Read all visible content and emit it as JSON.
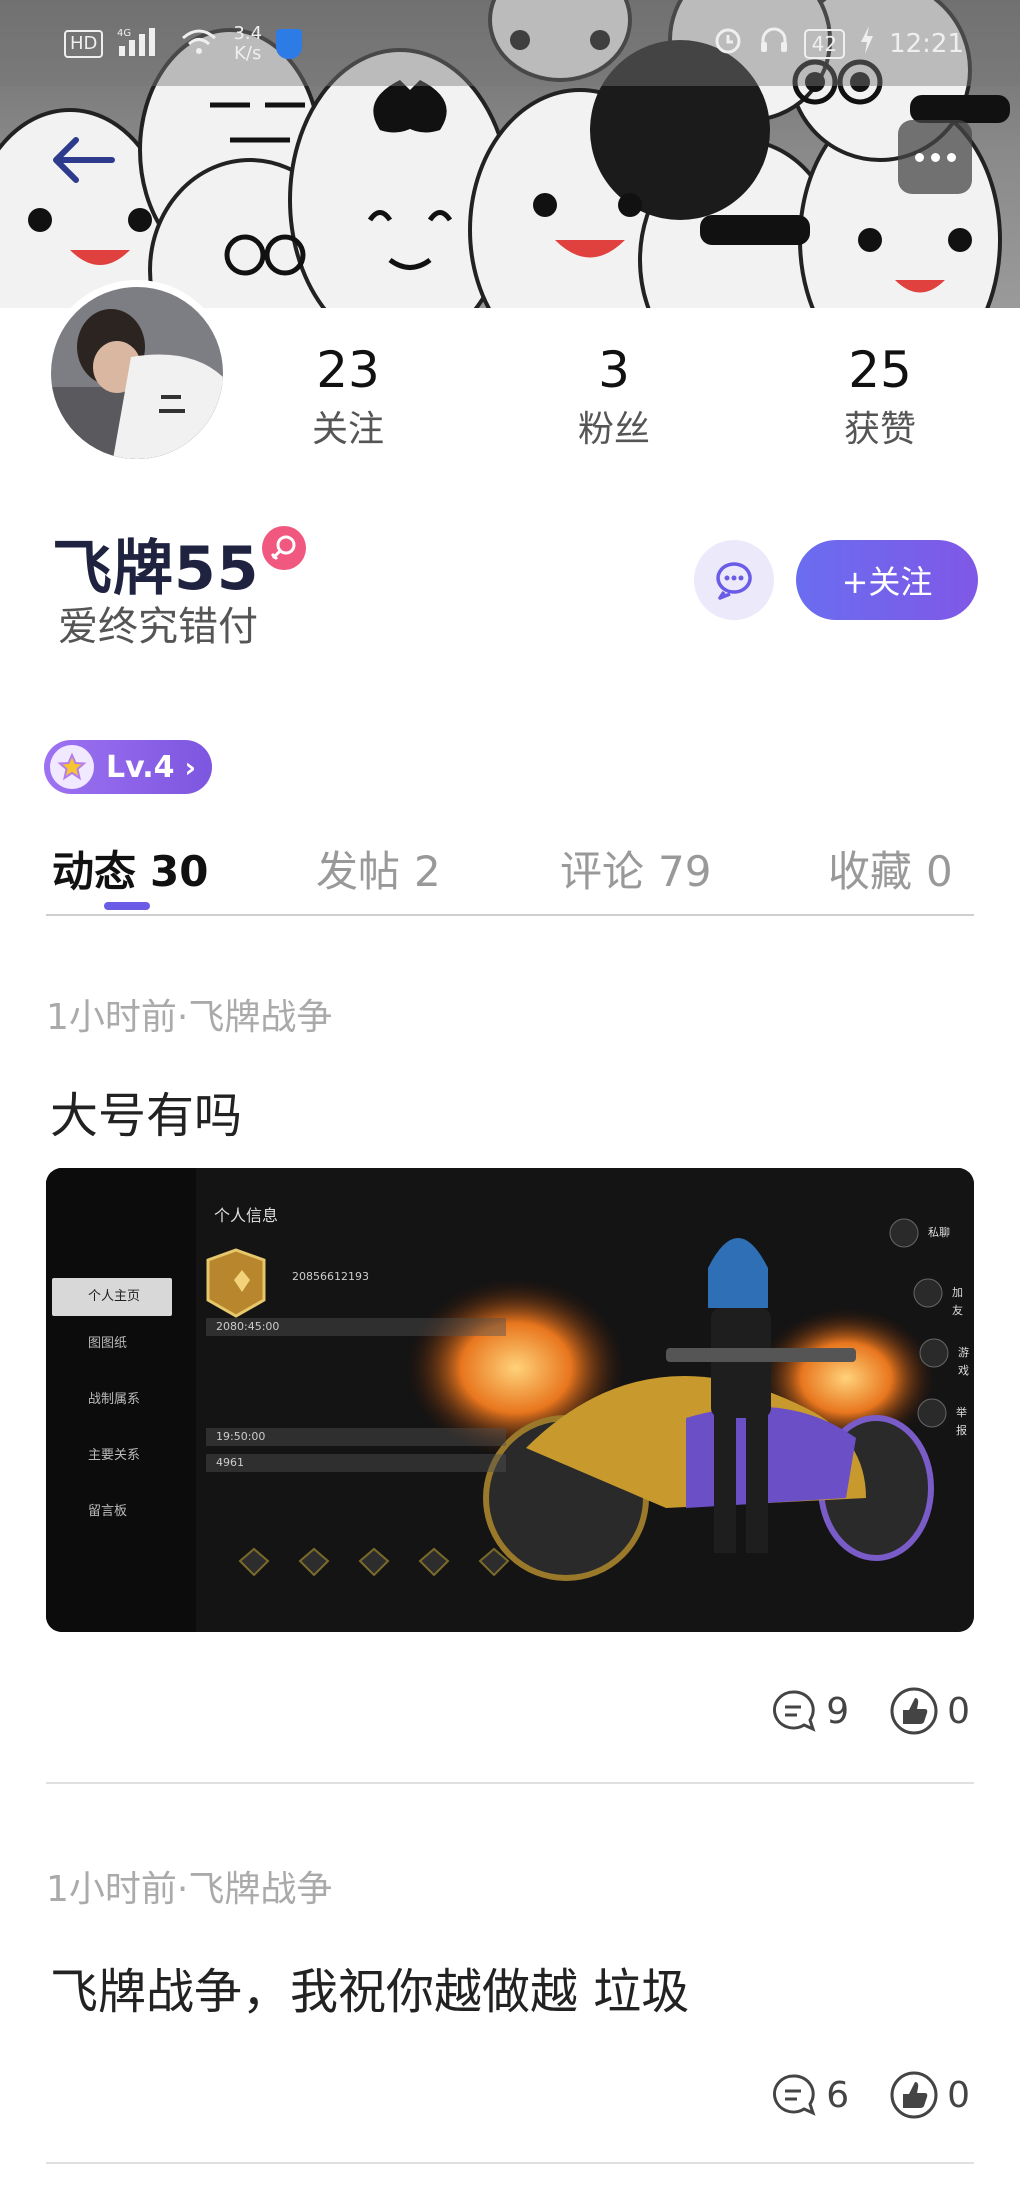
{
  "status_bar": {
    "network": "HD",
    "signal": "4G",
    "speed": "3.4",
    "speed_unit": "K/s",
    "battery": "42",
    "time": "12:21",
    "icons": [
      "hd-icon",
      "signal-icon",
      "wifi-icon",
      "shield-app-icon",
      "alarm-icon",
      "headset-icon",
      "battery-icon",
      "charging-icon"
    ]
  },
  "header": {
    "back_icon": "arrow-left-icon",
    "more_icon": "more-dots-icon"
  },
  "profile": {
    "username": "飞牌55",
    "bio": "爱终究错付",
    "gender_icon": "female-icon",
    "stats": [
      {
        "value": "23",
        "label": "关注"
      },
      {
        "value": "3",
        "label": "粉丝"
      },
      {
        "value": "25",
        "label": "获赞"
      }
    ],
    "message_icon": "chat-bubble-icon",
    "follow_label": "+关注",
    "level_label": "Lv.4"
  },
  "tabs": [
    {
      "label": "动态",
      "count": "30",
      "active": true
    },
    {
      "label": "发帖",
      "count": "2",
      "active": false
    },
    {
      "label": "评论",
      "count": "79",
      "active": false
    },
    {
      "label": "收藏",
      "count": "0",
      "active": false
    }
  ],
  "posts": [
    {
      "meta": "1小时前·飞牌战争",
      "title": "大号有吗",
      "has_image": true,
      "image": {
        "title": "个人信息",
        "menu": [
          "个人主页",
          "图图纸",
          "战制属系",
          "主要关系",
          "留言板"
        ],
        "values": [
          "20856612193",
          "2080:45:00",
          "19:50:00",
          "4961"
        ],
        "side_labels": [
          "私聊",
          "加友",
          "游戏",
          "举报"
        ]
      },
      "comments": "9",
      "likes": "0"
    },
    {
      "meta": "1小时前·飞牌战争",
      "title": "飞牌战争，我祝你越做越 垃圾",
      "has_image": false,
      "comments": "6",
      "likes": "0"
    }
  ],
  "colors": {
    "accent": "#6b5ce7",
    "follow_gradient_start": "#6a6df0",
    "follow_gradient_end": "#7f58e6",
    "gender_badge": "#f0587f",
    "level_badge": "#8a62e8"
  }
}
